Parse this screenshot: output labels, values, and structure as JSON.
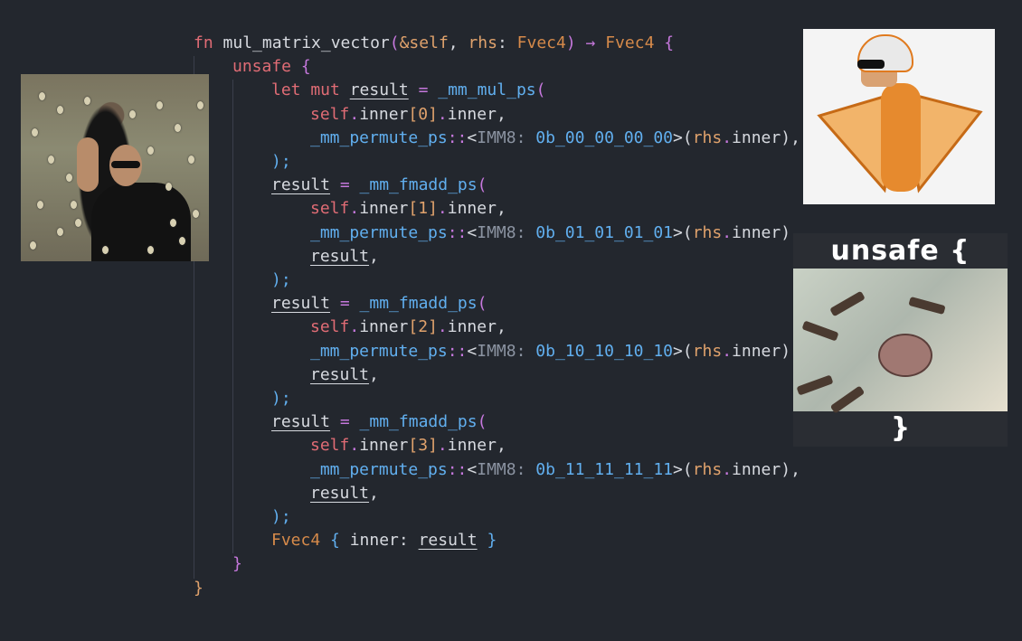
{
  "code": {
    "lines": [
      [
        {
          "t": "fn ",
          "c": "kw"
        },
        {
          "t": "mul_matrix_vector",
          "c": "fn"
        },
        {
          "t": "(",
          "c": "punc"
        },
        {
          "t": "&self",
          "c": "var"
        },
        {
          "t": ", ",
          "c": "plain"
        },
        {
          "t": "rhs",
          "c": "var"
        },
        {
          "t": ": ",
          "c": "plain"
        },
        {
          "t": "Fvec4",
          "c": "type"
        },
        {
          "t": ") → ",
          "c": "punc"
        },
        {
          "t": "Fvec4",
          "c": "type"
        },
        {
          "t": " {",
          "c": "punc"
        }
      ],
      [
        {
          "t": "unsafe ",
          "c": "kw"
        },
        {
          "t": "{",
          "c": "punc"
        }
      ],
      [
        {
          "t": "let mut ",
          "c": "kw"
        },
        {
          "t": "result",
          "c": "ident",
          "u": true
        },
        {
          "t": " = ",
          "c": "punc"
        },
        {
          "t": "_mm_mul_ps",
          "c": "call"
        },
        {
          "t": "(",
          "c": "punc"
        }
      ],
      [
        {
          "t": "self",
          "c": "kw"
        },
        {
          "t": ".",
          "c": "punc"
        },
        {
          "t": "inner",
          "c": "field"
        },
        {
          "t": "[0]",
          "c": "var"
        },
        {
          "t": ".",
          "c": "punc"
        },
        {
          "t": "inner",
          "c": "field"
        },
        {
          "t": ",",
          "c": "plain"
        }
      ],
      [
        {
          "t": "_mm_permute_ps",
          "c": "call"
        },
        {
          "t": "::",
          "c": "punc"
        },
        {
          "t": "<",
          "c": "plain"
        },
        {
          "t": "IMM8: ",
          "c": "hint"
        },
        {
          "t": "0b_00_00_00_00",
          "c": "num"
        },
        {
          "t": ">(",
          "c": "plain"
        },
        {
          "t": "rhs",
          "c": "var"
        },
        {
          "t": ".",
          "c": "punc"
        },
        {
          "t": "inner",
          "c": "field"
        },
        {
          "t": "),",
          "c": "plain"
        }
      ],
      [
        {
          "t": ");",
          "c": "call"
        }
      ],
      [
        {
          "t": "result",
          "c": "ident",
          "u": true
        },
        {
          "t": " = ",
          "c": "punc"
        },
        {
          "t": "_mm_fmadd_ps",
          "c": "call"
        },
        {
          "t": "(",
          "c": "punc"
        }
      ],
      [
        {
          "t": "self",
          "c": "kw"
        },
        {
          "t": ".",
          "c": "punc"
        },
        {
          "t": "inner",
          "c": "field"
        },
        {
          "t": "[1]",
          "c": "var"
        },
        {
          "t": ".",
          "c": "punc"
        },
        {
          "t": "inner",
          "c": "field"
        },
        {
          "t": ",",
          "c": "plain"
        }
      ],
      [
        {
          "t": "_mm_permute_ps",
          "c": "call"
        },
        {
          "t": "::",
          "c": "punc"
        },
        {
          "t": "<",
          "c": "plain"
        },
        {
          "t": "IMM8: ",
          "c": "hint"
        },
        {
          "t": "0b_01_01_01_01",
          "c": "num"
        },
        {
          "t": ">(",
          "c": "plain"
        },
        {
          "t": "rhs",
          "c": "var"
        },
        {
          "t": ".",
          "c": "punc"
        },
        {
          "t": "inner",
          "c": "field"
        },
        {
          "t": "),",
          "c": "plain"
        }
      ],
      [
        {
          "t": "result",
          "c": "ident",
          "u": true
        },
        {
          "t": ",",
          "c": "plain"
        }
      ],
      [
        {
          "t": ");",
          "c": "call"
        }
      ],
      [
        {
          "t": "result",
          "c": "ident",
          "u": true
        },
        {
          "t": " = ",
          "c": "punc"
        },
        {
          "t": "_mm_fmadd_ps",
          "c": "call"
        },
        {
          "t": "(",
          "c": "punc"
        }
      ],
      [
        {
          "t": "self",
          "c": "kw"
        },
        {
          "t": ".",
          "c": "punc"
        },
        {
          "t": "inner",
          "c": "field"
        },
        {
          "t": "[2]",
          "c": "var"
        },
        {
          "t": ".",
          "c": "punc"
        },
        {
          "t": "inner",
          "c": "field"
        },
        {
          "t": ",",
          "c": "plain"
        }
      ],
      [
        {
          "t": "_mm_permute_ps",
          "c": "call"
        },
        {
          "t": "::",
          "c": "punc"
        },
        {
          "t": "<",
          "c": "plain"
        },
        {
          "t": "IMM8: ",
          "c": "hint"
        },
        {
          "t": "0b_10_10_10_10",
          "c": "num"
        },
        {
          "t": ">(",
          "c": "plain"
        },
        {
          "t": "rhs",
          "c": "var"
        },
        {
          "t": ".",
          "c": "punc"
        },
        {
          "t": "inner",
          "c": "field"
        },
        {
          "t": "),",
          "c": "plain"
        }
      ],
      [
        {
          "t": "result",
          "c": "ident",
          "u": true
        },
        {
          "t": ",",
          "c": "plain"
        }
      ],
      [
        {
          "t": ");",
          "c": "call"
        }
      ],
      [
        {
          "t": "result",
          "c": "ident",
          "u": true
        },
        {
          "t": " = ",
          "c": "punc"
        },
        {
          "t": "_mm_fmadd_ps",
          "c": "call"
        },
        {
          "t": "(",
          "c": "punc"
        }
      ],
      [
        {
          "t": "self",
          "c": "kw"
        },
        {
          "t": ".",
          "c": "punc"
        },
        {
          "t": "inner",
          "c": "field"
        },
        {
          "t": "[3]",
          "c": "var"
        },
        {
          "t": ".",
          "c": "punc"
        },
        {
          "t": "inner",
          "c": "field"
        },
        {
          "t": ",",
          "c": "plain"
        }
      ],
      [
        {
          "t": "_mm_permute_ps",
          "c": "call"
        },
        {
          "t": "::",
          "c": "punc"
        },
        {
          "t": "<",
          "c": "plain"
        },
        {
          "t": "IMM8: ",
          "c": "hint"
        },
        {
          "t": "0b_11_11_11_11",
          "c": "num"
        },
        {
          "t": ">(",
          "c": "plain"
        },
        {
          "t": "rhs",
          "c": "var"
        },
        {
          "t": ".",
          "c": "punc"
        },
        {
          "t": "inner",
          "c": "field"
        },
        {
          "t": "),",
          "c": "plain"
        }
      ],
      [
        {
          "t": "result",
          "c": "ident",
          "u": true
        },
        {
          "t": ",",
          "c": "plain"
        }
      ],
      [
        {
          "t": ");",
          "c": "call"
        }
      ],
      [
        {
          "t": "Fvec4",
          "c": "type"
        },
        {
          "t": " { ",
          "c": "call"
        },
        {
          "t": "inner",
          "c": "field"
        },
        {
          "t": ": ",
          "c": "plain"
        },
        {
          "t": "result",
          "c": "ident",
          "u": true
        },
        {
          "t": " }",
          "c": "call"
        }
      ],
      [
        {
          "t": "}",
          "c": "punc"
        }
      ],
      [
        {
          "t": "}",
          "c": "var"
        }
      ]
    ]
  },
  "memes": {
    "unsafe_top": "unsafe {",
    "unsafe_bottom": "}",
    "matrix_icon": "neo-stopping-bullets-image",
    "vector_icon": "vector-wingsuit-image",
    "crab_icon": "crab-with-guns-image"
  },
  "colors": {
    "background": "#23272e",
    "keyword": "#e06c75",
    "call": "#61afef",
    "type": "#d68a4a",
    "punctuation": "#c678dd"
  }
}
